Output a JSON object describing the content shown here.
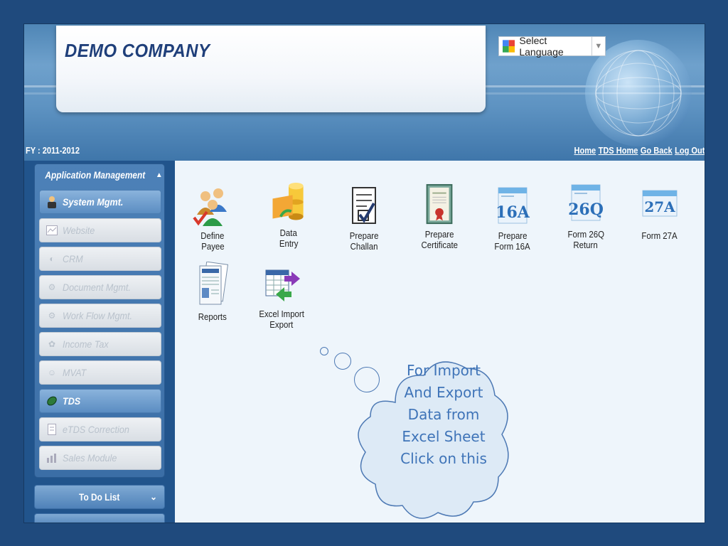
{
  "header": {
    "company_name": "DEMO COMPANY",
    "language_select": "Select Language",
    "fy_label": "FY : 2011-2012",
    "links": [
      "Home",
      "TDS Home",
      "Go Back",
      "Log Out"
    ]
  },
  "sidebar": {
    "section_title": "Application Management",
    "items": [
      {
        "label": "System Mgmt.",
        "icon": "user-icon",
        "active": true
      },
      {
        "label": "Website",
        "icon": "website-icon",
        "active": false
      },
      {
        "label": "CRM",
        "icon": "crm-icon",
        "active": false
      },
      {
        "label": "Document Mgmt.",
        "icon": "document-icon",
        "active": false
      },
      {
        "label": "Work Flow Mgmt.",
        "icon": "workflow-icon",
        "active": false
      },
      {
        "label": "Income Tax",
        "icon": "income-tax-icon",
        "active": false
      },
      {
        "label": "MVAT",
        "icon": "mvat-icon",
        "active": false
      },
      {
        "label": "TDS",
        "icon": "tds-icon",
        "active": true
      },
      {
        "label": "eTDS Correction",
        "icon": "etds-icon",
        "active": false
      },
      {
        "label": "Sales Module",
        "icon": "sales-icon",
        "active": false
      }
    ],
    "todo_label": "To Do List"
  },
  "main": {
    "tiles": [
      {
        "line1": "Define",
        "line2": "Payee",
        "icon": "people-icon"
      },
      {
        "line1": "Data",
        "line2": "Entry",
        "icon": "database-icon"
      },
      {
        "line1": "Prepare",
        "line2": "Challan",
        "icon": "checklist-icon"
      },
      {
        "line1": "Prepare",
        "line2": "Certificate",
        "icon": "certificate-icon"
      },
      {
        "line1": "Prepare",
        "line2": "Form 16A",
        "icon": "form-16a-icon",
        "badge": "16A"
      },
      {
        "line1": "Form 26Q",
        "line2": "Return",
        "icon": "form-26q-icon",
        "badge": "26Q"
      },
      {
        "line1": "Form 27A",
        "line2": "",
        "icon": "form-27a-icon",
        "badge": "27A"
      },
      {
        "line1": "Reports",
        "line2": "",
        "icon": "reports-icon"
      },
      {
        "line1": "Excel Import",
        "line2": "Export",
        "icon": "excel-import-export-icon"
      }
    ],
    "callout": {
      "lines": [
        "For Import",
        "And Export",
        "Data from",
        "Excel Sheet",
        "Click on this"
      ]
    }
  },
  "colors": {
    "page_background": "#1f4a7d",
    "header_blue": "#4f86b6",
    "company_text": "#1f3f7a",
    "callout_text": "#3f74b8"
  }
}
